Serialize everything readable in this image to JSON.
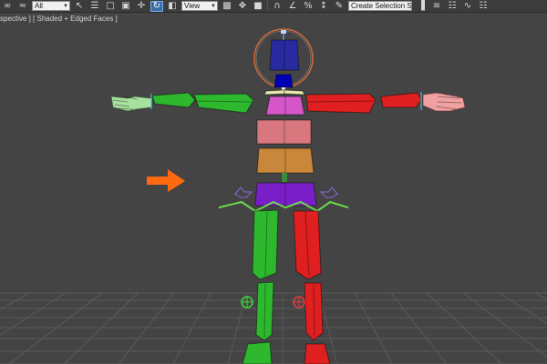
{
  "toolbar": {
    "selection_filter": "All",
    "reference_coord": "View",
    "named_selection": "Create Selection Se",
    "icons": [
      "link-icon",
      "bind-space-warp-icon",
      "select-icon",
      "select-by-name-icon",
      "rectangular-region-icon",
      "window-crossing-icon",
      "move-icon",
      "rotate-icon",
      "scale-icon",
      "pivot-center-icon",
      "mirror-icon",
      "snap-3d-icon",
      "angle-snap-icon",
      "percent-snap-icon",
      "spinner-snap-icon",
      "edit-named-selection-icon",
      "mirror-tool-icon",
      "align-icon",
      "layer-manager-icon",
      "curve-editor-icon"
    ]
  },
  "viewport": {
    "label_prefix": "]",
    "view_name": "Perspective",
    "view_name_visible": "spective",
    "separator": " ] [ ",
    "shading": "Shaded + Edged Faces",
    "label_suffix": " ]"
  },
  "colors": {
    "viewport_bg": "#444444",
    "grid_line": "#5a5a5a",
    "head": "#2a2aa0",
    "neck": "#0000b4",
    "spine_top": "#d456c8",
    "spine_mid": "#d8787e",
    "spine_low": "#c8873a",
    "pelvis": "#7a1fc8",
    "left_limb": "#2eb82e",
    "right_limb": "#e02020",
    "hand_left": "#a8e0a0",
    "hand_right": "#f0a0a0",
    "head_gizmo": "#d46a3a",
    "arrow": "#ff6a10",
    "footstep_helper": "#8c6ad8"
  },
  "scene": {
    "object": "biped-character",
    "pose": "T-pose",
    "annotation": "orange-arrow-pointing-at-pelvis"
  }
}
